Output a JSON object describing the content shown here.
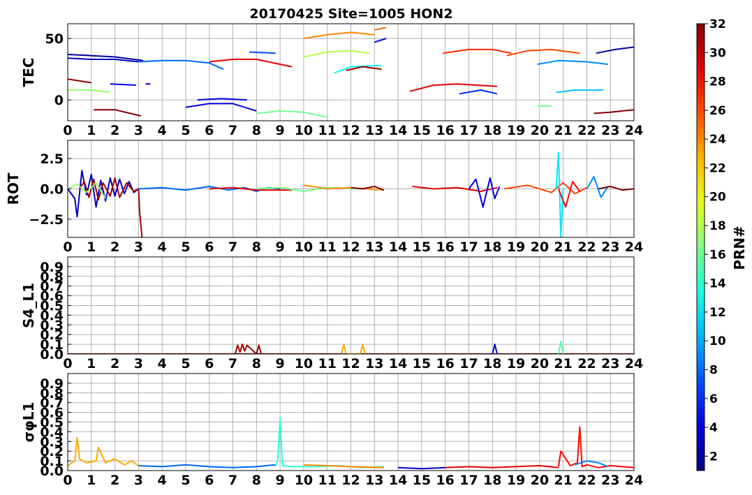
{
  "title": "20170425 Site=1005 HON2",
  "colorbar": {
    "label": "PRN#",
    "min": 1,
    "max": 32,
    "ticks": [
      "2",
      "4",
      "6",
      "8",
      "10",
      "12",
      "14",
      "16",
      "18",
      "20",
      "22",
      "24",
      "26",
      "28",
      "30",
      "32"
    ]
  },
  "chart_data": [
    {
      "type": "line",
      "ylabel": "TEC",
      "xlim": [
        0,
        24
      ],
      "ylim": [
        -17,
        62
      ],
      "xticks": [
        "0",
        "1",
        "2",
        "3",
        "4",
        "5",
        "6",
        "7",
        "8",
        "9",
        "10",
        "11",
        "12",
        "13",
        "14",
        "15",
        "16",
        "17",
        "18",
        "19",
        "20",
        "21",
        "22",
        "23",
        "24"
      ],
      "yticks": [
        {
          "v": 0,
          "label": "0"
        },
        {
          "v": 50,
          "label": "50"
        }
      ],
      "grid": true,
      "series": [
        {
          "prn": 2,
          "x": [
            0,
            1,
            2,
            3.2
          ],
          "y": [
            37,
            36,
            35,
            32
          ]
        },
        {
          "prn": 3,
          "x": [
            0,
            1,
            2,
            3
          ],
          "y": [
            34,
            33,
            33,
            31
          ]
        },
        {
          "prn": 8,
          "x": [
            3,
            4,
            5,
            6,
            6.6
          ],
          "y": [
            31,
            32,
            32,
            30,
            25
          ]
        },
        {
          "prn": 29,
          "x": [
            6,
            7,
            8,
            9.5
          ],
          "y": [
            31,
            33,
            33,
            27
          ]
        },
        {
          "prn": 7,
          "x": [
            7.7,
            8.8
          ],
          "y": [
            39,
            38
          ]
        },
        {
          "prn": 24,
          "x": [
            10,
            11,
            12,
            13
          ],
          "y": [
            50,
            53,
            55,
            53
          ]
        },
        {
          "prn": 25,
          "x": [
            13,
            13.5
          ],
          "y": [
            57,
            59
          ]
        },
        {
          "prn": 4,
          "x": [
            13,
            13.5
          ],
          "y": [
            47,
            50
          ]
        },
        {
          "prn": 18,
          "x": [
            10,
            11,
            12,
            12.8
          ],
          "y": [
            35,
            39,
            40,
            38
          ]
        },
        {
          "prn": 13,
          "x": [
            11.3,
            12,
            13.3
          ],
          "y": [
            22,
            27,
            28
          ]
        },
        {
          "prn": 31,
          "x": [
            11.8,
            12.5,
            13.3
          ],
          "y": [
            24,
            27,
            25
          ]
        },
        {
          "prn": 31,
          "x": [
            0,
            1
          ],
          "y": [
            17,
            14
          ]
        },
        {
          "prn": 17,
          "x": [
            0,
            1,
            1.8
          ],
          "y": [
            8,
            8,
            6
          ]
        },
        {
          "prn": 5,
          "x": [
            1.8,
            2.9
          ],
          "y": [
            13,
            12
          ]
        },
        {
          "prn": 4,
          "x": [
            3.3,
            3.5
          ],
          "y": [
            13,
            13
          ]
        },
        {
          "prn": 32,
          "x": [
            1.1,
            2,
            3.1
          ],
          "y": [
            -8,
            -8,
            -13
          ]
        },
        {
          "prn": 4,
          "x": [
            5,
            6,
            7,
            8
          ],
          "y": [
            -6,
            -3,
            -3,
            -9
          ]
        },
        {
          "prn": 4,
          "x": [
            5.5,
            6.5,
            7.6
          ],
          "y": [
            0,
            1,
            0
          ]
        },
        {
          "prn": 16,
          "x": [
            8,
            9,
            10,
            11
          ],
          "y": [
            -11,
            -9,
            -10,
            -14
          ]
        },
        {
          "prn": 29,
          "x": [
            14.5,
            15.5,
            16.5,
            18.2
          ],
          "y": [
            7,
            12,
            13,
            11
          ]
        },
        {
          "prn": 6,
          "x": [
            16.6,
            17.5,
            18.2
          ],
          "y": [
            5,
            8,
            5
          ]
        },
        {
          "prn": 27,
          "x": [
            15.9,
            17,
            18,
            18.8
          ],
          "y": [
            38,
            41,
            41,
            38
          ]
        },
        {
          "prn": 26,
          "x": [
            18.6,
            19.5,
            20.5,
            21.7
          ],
          "y": [
            36,
            40,
            41,
            38
          ]
        },
        {
          "prn": 9,
          "x": [
            19.9,
            20.8,
            22,
            22.9
          ],
          "y": [
            29,
            32,
            31,
            29
          ]
        },
        {
          "prn": 11,
          "x": [
            20.7,
            21.5,
            22.7
          ],
          "y": [
            6,
            8,
            8
          ]
        },
        {
          "prn": 16,
          "x": [
            19.9,
            20.5
          ],
          "y": [
            -5,
            -5
          ]
        },
        {
          "prn": 2,
          "x": [
            22.4,
            23.2,
            24
          ],
          "y": [
            38,
            41,
            43
          ]
        },
        {
          "prn": 32,
          "x": [
            22.3,
            23,
            24
          ],
          "y": [
            -11,
            -10,
            -8
          ]
        }
      ]
    },
    {
      "type": "line",
      "ylabel": "ROT",
      "xlim": [
        0,
        24
      ],
      "ylim": [
        -4,
        4
      ],
      "xticks": [
        "0",
        "1",
        "2",
        "3",
        "4",
        "5",
        "6",
        "7",
        "8",
        "9",
        "10",
        "11",
        "12",
        "13",
        "14",
        "15",
        "16",
        "17",
        "18",
        "19",
        "20",
        "21",
        "22",
        "23",
        "24"
      ],
      "yticks": [
        {
          "v": -2.5,
          "label": "−2.5"
        },
        {
          "v": 0,
          "label": "0.0"
        },
        {
          "v": 2.5,
          "label": "2.5"
        }
      ],
      "grid": true,
      "series": [
        {
          "prn": 3,
          "x": [
            0,
            0.3,
            0.4,
            0.6,
            0.8,
            1,
            1.2,
            1.4,
            1.6,
            1.8,
            2,
            2.2,
            2.4,
            2.6,
            2.8,
            3
          ],
          "y": [
            0,
            -0.8,
            -2.3,
            1.5,
            -0.5,
            1.2,
            -1.5,
            0.7,
            -1,
            0.9,
            -0.6,
            0.8,
            -0.4,
            0.6,
            -0.3,
            0
          ]
        },
        {
          "prn": 31,
          "x": [
            0.5,
            0.7,
            0.9,
            1.1,
            1.3,
            1.5,
            1.8,
            2,
            2.2,
            2.5,
            2.8,
            3,
            3.05,
            3.15
          ],
          "y": [
            0,
            0.6,
            -0.7,
            0.8,
            -0.9,
            0.5,
            -0.6,
            0.9,
            -0.7,
            0.5,
            -0.2,
            0,
            -2,
            -4
          ]
        },
        {
          "prn": 17,
          "x": [
            0,
            0.4,
            0.8,
            1.2,
            1.6
          ],
          "y": [
            0,
            0.4,
            -0.3,
            0.5,
            -0.8
          ]
        },
        {
          "prn": 8,
          "x": [
            3,
            4,
            5,
            6,
            6.8,
            7.5,
            8,
            8.5,
            9
          ],
          "y": [
            0,
            0.1,
            -0.1,
            0.2,
            -0.1,
            0.1,
            -0.2,
            0.1,
            0
          ]
        },
        {
          "prn": 29,
          "x": [
            6,
            7,
            8,
            9.5
          ],
          "y": [
            0,
            0.1,
            -0.1,
            -0.1
          ]
        },
        {
          "prn": 16,
          "x": [
            8,
            9,
            10,
            11,
            12.5
          ],
          "y": [
            0,
            0.1,
            -0.2,
            0.1,
            0
          ]
        },
        {
          "prn": 24,
          "x": [
            10,
            11,
            12,
            13.4
          ],
          "y": [
            0.3,
            0,
            0.1,
            -0.1
          ]
        },
        {
          "prn": 32,
          "x": [
            12,
            12.5,
            13,
            13.4
          ],
          "y": [
            0.1,
            0,
            0.2,
            -0.1
          ]
        },
        {
          "prn": 29,
          "x": [
            14.6,
            15.5,
            16.5,
            17.5,
            18.2
          ],
          "y": [
            0.2,
            0,
            0.1,
            -0.2,
            0.1
          ]
        },
        {
          "prn": 4,
          "x": [
            17,
            17.3,
            17.6,
            17.9,
            18.1,
            18.3
          ],
          "y": [
            0,
            0.8,
            -1.5,
            0.9,
            -0.8,
            0.2
          ]
        },
        {
          "prn": 26,
          "x": [
            18.5,
            19.5,
            20.5,
            21,
            21.5,
            22
          ],
          "y": [
            0,
            0.3,
            -0.3,
            0.5,
            -0.4,
            0.1
          ]
        },
        {
          "prn": 12,
          "x": [
            20.7,
            20.8,
            20.9,
            21
          ],
          "y": [
            0,
            3,
            -4,
            0
          ]
        },
        {
          "prn": 28,
          "x": [
            20.8,
            21.1,
            21.4,
            21.7
          ],
          "y": [
            0,
            -1.5,
            0.6,
            -0.2
          ]
        },
        {
          "prn": 9,
          "x": [
            22,
            22.3,
            22.6,
            22.9
          ],
          "y": [
            0,
            1,
            -0.7,
            0.2
          ]
        },
        {
          "prn": 32,
          "x": [
            22.5,
            23,
            23.5,
            24
          ],
          "y": [
            0,
            0.2,
            -0.1,
            0
          ]
        }
      ]
    },
    {
      "type": "line",
      "ylabel": "S4_L1",
      "xlim": [
        0,
        24
      ],
      "ylim": [
        0,
        1
      ],
      "xticks": [
        "0",
        "1",
        "2",
        "3",
        "4",
        "5",
        "6",
        "7",
        "8",
        "9",
        "10",
        "11",
        "12",
        "13",
        "14",
        "15",
        "16",
        "17",
        "18",
        "19",
        "20",
        "21",
        "22",
        "23",
        "24"
      ],
      "yticks": [
        {
          "v": 0,
          "label": "0.0"
        },
        {
          "v": 0.1,
          "label": "0.1"
        },
        {
          "v": 0.2,
          "label": "0.2"
        },
        {
          "v": 0.3,
          "label": "0.3"
        },
        {
          "v": 0.4,
          "label": "0.4"
        },
        {
          "v": 0.5,
          "label": "0.5"
        },
        {
          "v": 0.6,
          "label": "0.6"
        },
        {
          "v": 0.7,
          "label": "0.7"
        },
        {
          "v": 0.8,
          "label": "0.8"
        },
        {
          "v": 0.9,
          "label": "0.9"
        }
      ],
      "grid": true,
      "series": [
        {
          "prn": 31,
          "x": [
            0,
            3,
            6,
            9,
            12,
            15,
            18,
            21,
            24
          ],
          "y": [
            0,
            0,
            0,
            0,
            0,
            0,
            0,
            0,
            0
          ]
        },
        {
          "prn": 31,
          "x": [
            7.1,
            7.2,
            7.3,
            7.4,
            7.5,
            7.6,
            8,
            8.1,
            8.2
          ],
          "y": [
            0,
            0.09,
            0.02,
            0.1,
            0.03,
            0.09,
            0,
            0.09,
            0
          ]
        },
        {
          "prn": 23,
          "x": [
            11.6,
            11.7,
            11.8,
            12.4,
            12.5,
            12.6
          ],
          "y": [
            0,
            0.1,
            0,
            0,
            0.1,
            0
          ]
        },
        {
          "prn": 4,
          "x": [
            18,
            18.1,
            18.2
          ],
          "y": [
            0,
            0.1,
            0
          ]
        },
        {
          "prn": 15,
          "x": [
            20.8,
            20.9,
            21
          ],
          "y": [
            0,
            0.13,
            0
          ]
        }
      ]
    },
    {
      "type": "line",
      "ylabel": "σφL1",
      "xlim": [
        0,
        24
      ],
      "ylim": [
        0,
        1
      ],
      "xticks": [
        "0",
        "1",
        "2",
        "3",
        "4",
        "5",
        "6",
        "7",
        "8",
        "9",
        "10",
        "11",
        "12",
        "13",
        "14",
        "15",
        "16",
        "17",
        "18",
        "19",
        "20",
        "21",
        "22",
        "23",
        "24"
      ],
      "yticks": [
        {
          "v": 0,
          "label": "0.0"
        },
        {
          "v": 0.1,
          "label": "0.1"
        },
        {
          "v": 0.2,
          "label": "0.2"
        },
        {
          "v": 0.3,
          "label": "0.3"
        },
        {
          "v": 0.4,
          "label": "0.4"
        },
        {
          "v": 0.5,
          "label": "0.5"
        },
        {
          "v": 0.6,
          "label": "0.6"
        },
        {
          "v": 0.7,
          "label": "0.7"
        },
        {
          "v": 0.8,
          "label": "0.8"
        },
        {
          "v": 0.9,
          "label": "0.9"
        }
      ],
      "grid": true,
      "series": [
        {
          "prn": 23,
          "x": [
            0,
            0.3,
            0.4,
            0.5,
            0.8,
            1.2,
            1.3,
            1.6,
            2,
            2.4,
            2.7,
            3
          ],
          "y": [
            0.05,
            0.1,
            0.34,
            0.12,
            0.08,
            0.1,
            0.24,
            0.08,
            0.12,
            0.06,
            0.1,
            0.05
          ]
        },
        {
          "prn": 8,
          "x": [
            3,
            4,
            5,
            6,
            7,
            8,
            8.8
          ],
          "y": [
            0.05,
            0.04,
            0.06,
            0.04,
            0.03,
            0.04,
            0.06
          ]
        },
        {
          "prn": 14,
          "x": [
            8.8,
            8.9,
            9,
            9.1,
            9.5,
            10.5,
            11.5,
            12.5,
            13.4
          ],
          "y": [
            0.04,
            0.1,
            0.54,
            0.05,
            0.04,
            0.04,
            0.05,
            0.03,
            0.04
          ]
        },
        {
          "prn": 24,
          "x": [
            10,
            11,
            12,
            13.4
          ],
          "y": [
            0.06,
            0.05,
            0.04,
            0.03
          ]
        },
        {
          "prn": 3,
          "x": [
            14,
            15,
            16
          ],
          "y": [
            0.03,
            0.02,
            0.03
          ]
        },
        {
          "prn": 29,
          "x": [
            16,
            17,
            18,
            19,
            20,
            20.8
          ],
          "y": [
            0.03,
            0.04,
            0.03,
            0.04,
            0.05,
            0.03
          ]
        },
        {
          "prn": 28,
          "x": [
            20.8,
            20.9,
            21.3,
            21.6,
            21.7,
            21.8,
            22,
            22.5,
            23,
            24
          ],
          "y": [
            0.04,
            0.2,
            0.05,
            0.08,
            0.45,
            0.04,
            0.06,
            0.03,
            0.05,
            0.03
          ]
        },
        {
          "prn": 9,
          "x": [
            21.5,
            22,
            22.5,
            22.9
          ],
          "y": [
            0.06,
            0.1,
            0.08,
            0.04
          ]
        }
      ]
    }
  ]
}
